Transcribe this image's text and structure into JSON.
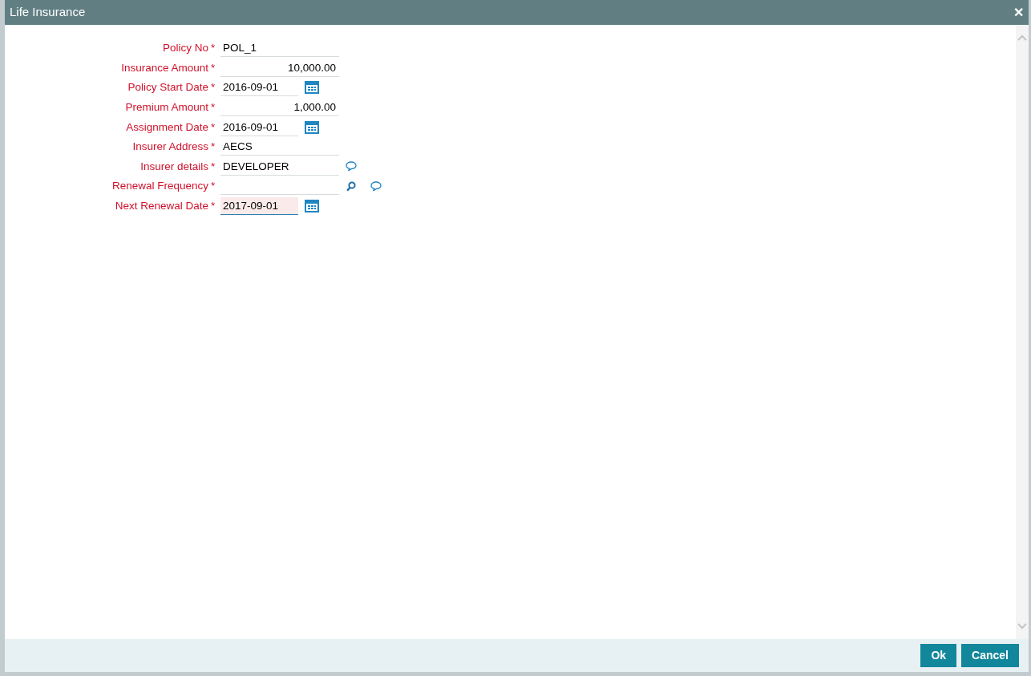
{
  "window": {
    "title": "Life Insurance",
    "close": "✕"
  },
  "fields": [
    {
      "label": "Policy No",
      "required_mark": "*",
      "value": "POL_1",
      "kind": "text",
      "focused": false
    },
    {
      "label": "Insurance Amount",
      "required_mark": "*",
      "value": "10,000.00",
      "kind": "amount",
      "focused": false
    },
    {
      "label": "Policy Start Date",
      "required_mark": "*",
      "value": "2016-09-01",
      "kind": "date",
      "focused": false
    },
    {
      "label": "Premium Amount",
      "required_mark": "*",
      "value": "1,000.00",
      "kind": "amount",
      "focused": false
    },
    {
      "label": "Assignment Date",
      "required_mark": "*",
      "value": "2016-09-01",
      "kind": "date",
      "focused": false
    },
    {
      "label": "Insurer Address",
      "required_mark": "*",
      "value": "AECS",
      "kind": "text",
      "focused": false
    },
    {
      "label": "Insurer details",
      "required_mark": "*",
      "value": "DEVELOPER",
      "kind": "note",
      "focused": false
    },
    {
      "label": "Renewal Frequency",
      "required_mark": "*",
      "kind": "lookup",
      "focused": false
    },
    {
      "label": "Next Renewal Date",
      "required_mark": "*",
      "value": "2017-09-01",
      "kind": "date",
      "focused": true
    }
  ],
  "buttons": [
    "Ok",
    "Cancel"
  ]
}
